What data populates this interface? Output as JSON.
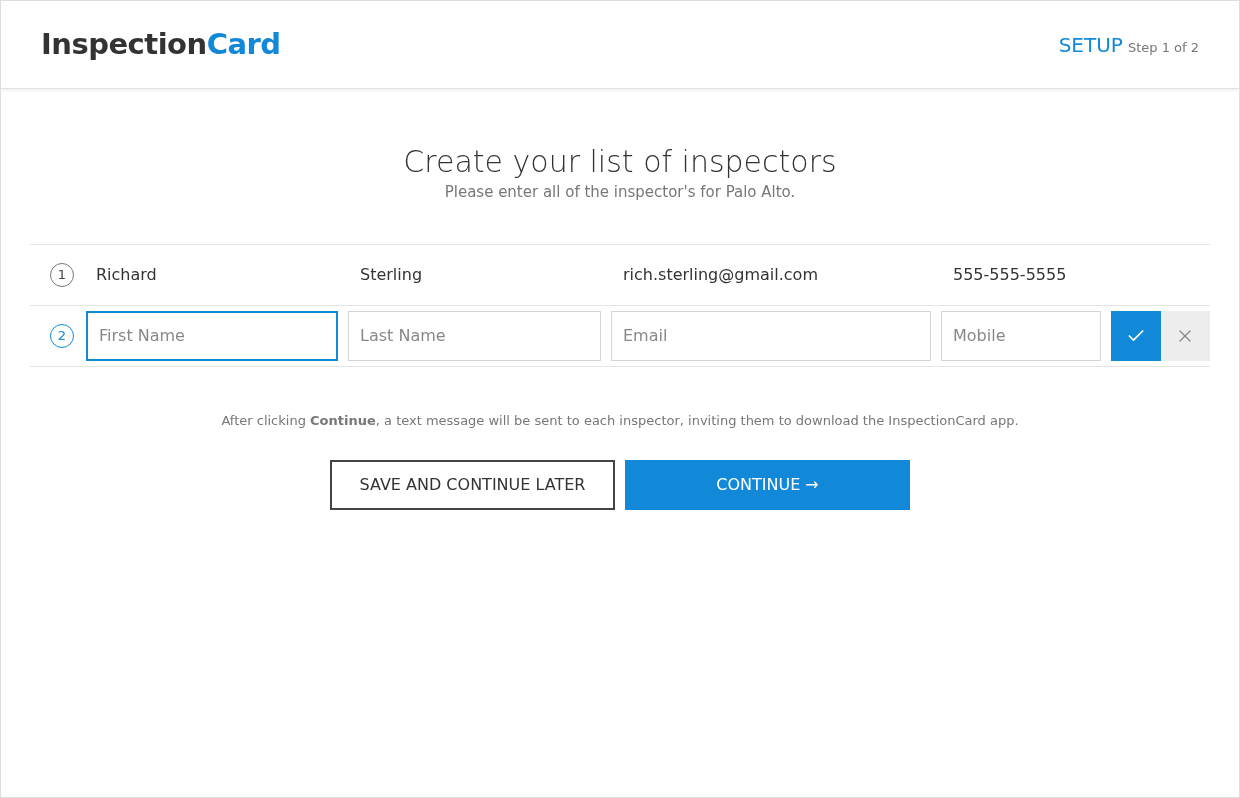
{
  "header": {
    "logo": {
      "first": "Inspection",
      "second": "Card"
    },
    "step_title": "SETUP",
    "step_text": "Step 1 of 2"
  },
  "title": "Create your list of inspectors",
  "subtitle": "Please enter all of the inspector's for Palo Alto.",
  "inspectors": [
    {
      "kind": "saved",
      "number": "1",
      "first_name": "Richard",
      "last_name": "Sterling",
      "email": "rich.sterling@gmail.com",
      "mobile": "555-555-5555"
    },
    {
      "kind": "editing",
      "number": "2",
      "fields": [
        {
          "placeholder": "First Name",
          "focused": true
        },
        {
          "placeholder": "Last Name",
          "focused": false
        },
        {
          "placeholder": "Email",
          "focused": false
        },
        {
          "placeholder": "Mobile",
          "focused": false
        }
      ]
    }
  ],
  "note": "After clicking **Continue**, a text message will be sent to each inspector, inviting them to download the InspectionCard app.",
  "buttons": [
    {
      "kind": "secondary",
      "label": "SAVE AND CONTINUE LATER"
    },
    {
      "kind": "primary",
      "label": "CONTINUE →"
    }
  ]
}
